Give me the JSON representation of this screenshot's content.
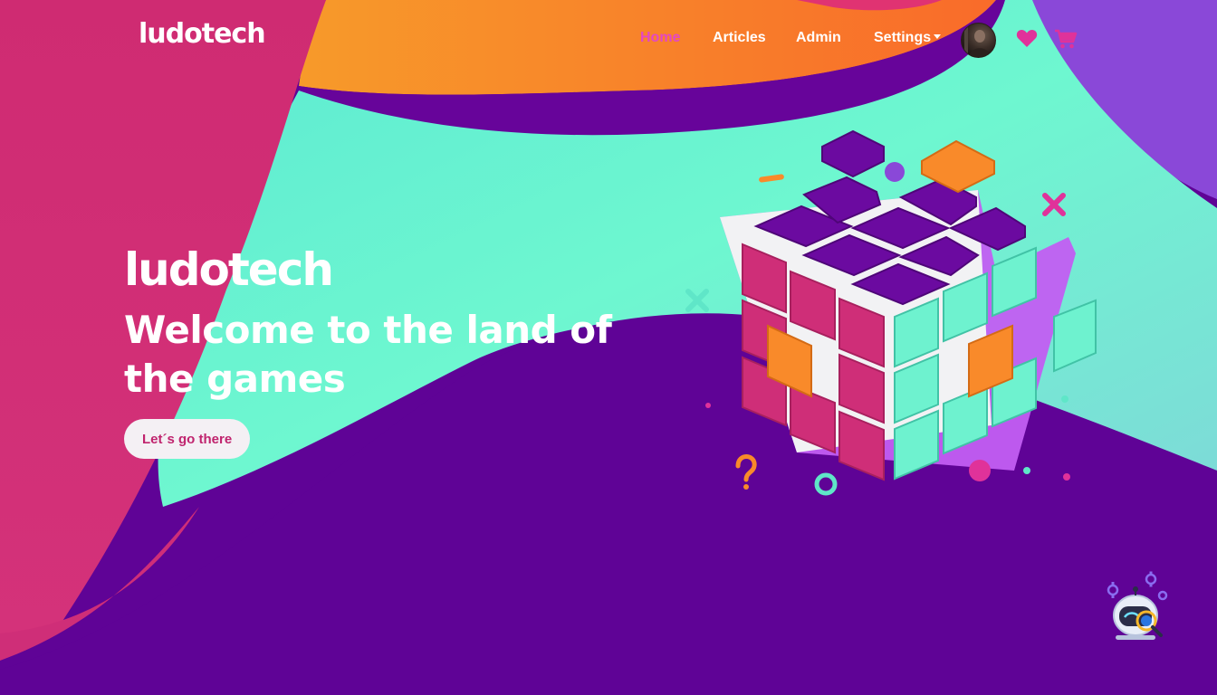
{
  "navbar": {
    "brand": "ludotech",
    "links": [
      {
        "label": "Home",
        "active": true
      },
      {
        "label": "Articles",
        "active": false
      },
      {
        "label": "Admin",
        "active": false
      },
      {
        "label": "Settings",
        "active": false
      }
    ],
    "icons": {
      "avatar": "user-avatar",
      "favorites": "heart-icon",
      "cart": "cart-icon"
    }
  },
  "hero": {
    "brand": "ludotech",
    "title": "Welcome to the land of the games",
    "cta_label": "Let´s go there"
  },
  "decor": {
    "illustration": "rubik-cube-illustration",
    "assistant": "robot-assistant-icon"
  },
  "colors": {
    "magenta": "#cf2e78",
    "orange": "#f98a2a",
    "purple": "#5f0396",
    "mint": "#6ef2cf",
    "violet": "#8a48d8",
    "active_link": "#e447c4"
  }
}
